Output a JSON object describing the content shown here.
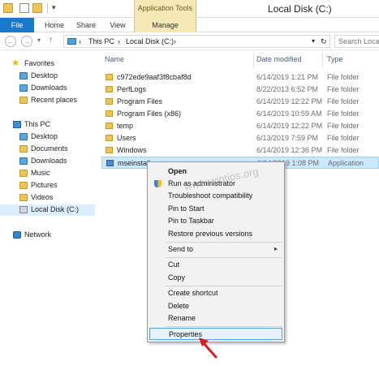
{
  "window": {
    "title": "Local Disk (C:)"
  },
  "titlebar": {
    "contextual_tab_group": "Application Tools"
  },
  "ribbon": {
    "tabs": [
      "File",
      "Home",
      "Share",
      "View",
      "Manage"
    ]
  },
  "address": {
    "breadcrumbs": [
      "This PC",
      "Local Disk (C:)"
    ],
    "search_placeholder": "Search Local"
  },
  "nav": {
    "favorites_header": "Favorites",
    "favorites": [
      "Desktop",
      "Downloads",
      "Recent places"
    ],
    "thispc_header": "This PC",
    "thispc": [
      "Desktop",
      "Documents",
      "Downloads",
      "Music",
      "Pictures",
      "Videos",
      "Local Disk (C:)"
    ],
    "network": "Network"
  },
  "columns": {
    "name": "Name",
    "date": "Date modified",
    "type": "Type"
  },
  "files": [
    {
      "name": "c972ede9aaf3f8cbaf8d",
      "date": "6/14/2019 1:21 PM",
      "type": "File folder"
    },
    {
      "name": "PerfLogs",
      "date": "8/22/2013 6:52 PM",
      "type": "File folder"
    },
    {
      "name": "Program Files",
      "date": "6/14/2019 12:22 PM",
      "type": "File folder"
    },
    {
      "name": "Program Files (x86)",
      "date": "6/14/2019 10:59 AM",
      "type": "File folder"
    },
    {
      "name": "temp",
      "date": "6/14/2019 12:22 PM",
      "type": "File folder"
    },
    {
      "name": "Users",
      "date": "6/13/2019 7:59 PM",
      "type": "File folder"
    },
    {
      "name": "Windows",
      "date": "6/14/2019 12:36 PM",
      "type": "File folder"
    },
    {
      "name": "mseinstall",
      "date": "6/14/2019 1:08 PM",
      "type": "Application"
    }
  ],
  "context_menu": {
    "open": "Open",
    "run_as_admin": "Run as administrator",
    "troubleshoot": "Troubleshoot compatibility",
    "pin_start": "Pin to Start",
    "pin_taskbar": "Pin to Taskbar",
    "restore": "Restore previous versions",
    "send_to": "Send to",
    "cut": "Cut",
    "copy": "Copy",
    "create_shortcut": "Create shortcut",
    "delete": "Delete",
    "rename": "Rename",
    "properties": "Properties"
  },
  "watermark": "www.wintips.org",
  "colors": {
    "accent": "#1979ca",
    "contextual": "#f7e9b6",
    "selection": "#cce8ff",
    "pointer": "#d81e1e"
  }
}
